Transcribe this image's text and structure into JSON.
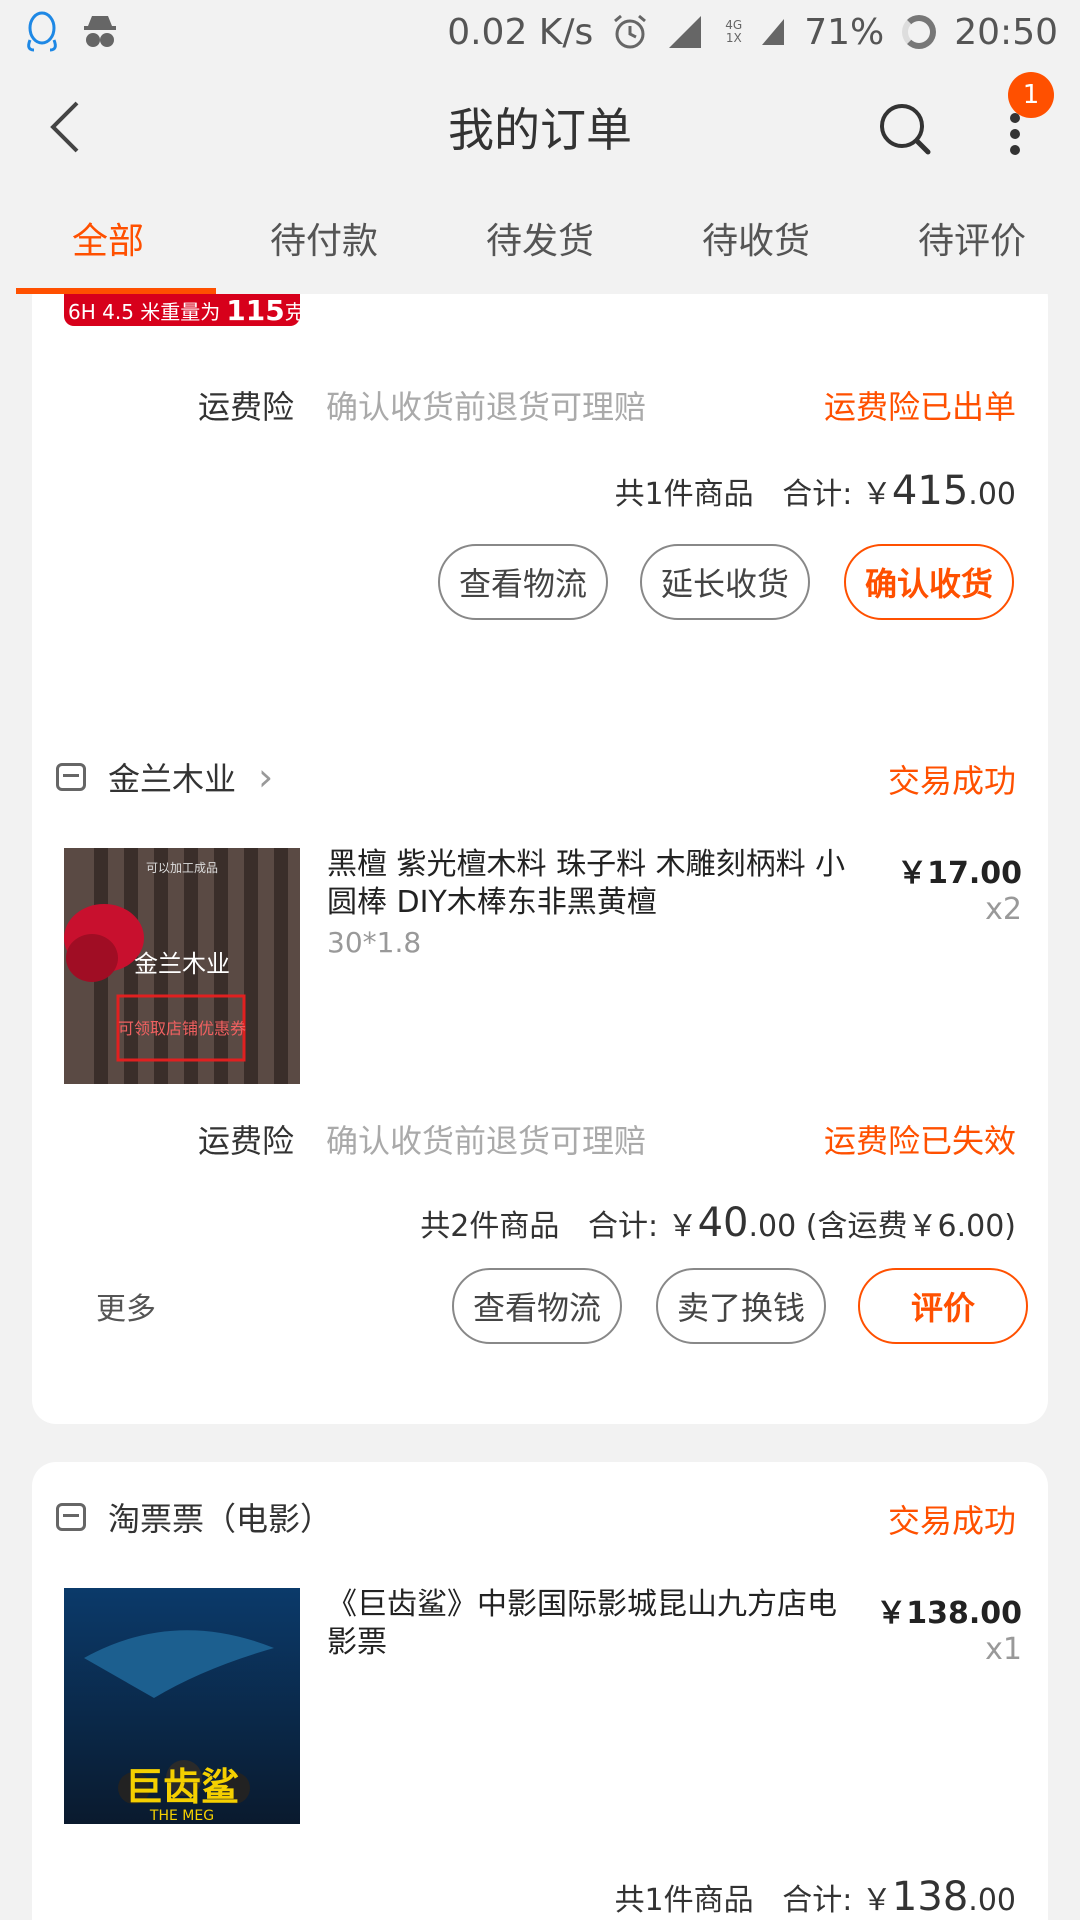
{
  "status_bar": {
    "net_speed": "0.02 K/s",
    "network_label_top": "4G",
    "network_label_bottom": "1X",
    "battery": "71%",
    "time": "20:50",
    "icons": [
      "qq-icon",
      "incognito-icon",
      "alarm-icon",
      "signal-icon",
      "battery-icon"
    ]
  },
  "navbar": {
    "title": "我的订单",
    "notification_count": "1"
  },
  "tabs": [
    {
      "label": "全部",
      "active": true
    },
    {
      "label": "待付款",
      "active": false
    },
    {
      "label": "待发货",
      "active": false
    },
    {
      "label": "待收货",
      "active": false
    },
    {
      "label": "待评价",
      "active": false
    }
  ],
  "orders": [
    {
      "partial_image_text": "6H 4.5 米重量为",
      "partial_image_text_big": "115",
      "partial_image_text_unit": "克",
      "insurance_label": "运费险",
      "insurance_desc": "确认收货前退货可理赔",
      "insurance_status": "运费险已出单",
      "summary_count": "共1件商品",
      "summary_total_label": "合计:",
      "summary_currency": "￥",
      "summary_total_int": "415",
      "summary_total_dec": ".00",
      "buttons": [
        "查看物流",
        "延长收货",
        "确认收货"
      ]
    },
    {
      "shop_name": "金兰木业",
      "status": "交易成功",
      "product_title": "黑檀 紫光檀木料 珠子料 木雕刻柄料 小圆棒 DIY木棒东非黑黄檀",
      "product_spec": "30*1.8",
      "product_price": "￥17.00",
      "product_qty": "x2",
      "thumb_text": "金兰木业",
      "thumb_stamp": "可领取店铺优惠券",
      "thumb_top_text": "可以加工成品",
      "insurance_label": "运费险",
      "insurance_desc": "确认收货前退货可理赔",
      "insurance_status": "运费险已失效",
      "summary_count": "共2件商品",
      "summary_total_label": "合计:",
      "summary_currency": "￥",
      "summary_total_int": "40",
      "summary_total_dec": ".00",
      "summary_shipping": "(含运费￥6.00)",
      "more_label": "更多",
      "buttons": [
        "查看物流",
        "卖了换钱",
        "评价"
      ]
    },
    {
      "shop_name": "淘票票（电影）",
      "status": "交易成功",
      "product_title": "《巨齿鲨》中影国际影城昆山九方店电影票",
      "product_price": "￥138.00",
      "product_qty": "x1",
      "poster_title": "巨齿鲨",
      "poster_subtitle": "THE MEG",
      "summary_count": "共1件商品",
      "summary_total_label": "合计:",
      "summary_currency": "￥",
      "summary_total_int": "138",
      "summary_total_dec": ".00"
    }
  ],
  "colors": {
    "accent": "#ff5000",
    "background": "#f2f2f2",
    "card": "#ffffff"
  }
}
